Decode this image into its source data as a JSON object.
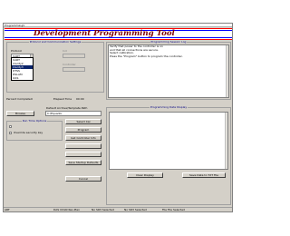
{
  "window": {
    "title": "ProgrammingV"
  },
  "banner": {
    "title": "Development Programming Tool",
    "stripe_colors": [
      "#ff0000",
      "#0000ff"
    ]
  },
  "protocol": {
    "group_title": "Protocol and Communication Settings",
    "protocol_label": "Protocol",
    "selected": "UART",
    "options": [
      "UART",
      "Clarity2",
      "Clarity3",
      "DTSS",
      "DSLAM",
      "ILSS"
    ],
    "highlighted_option": "Clarity3",
    "right_label": "Ind",
    "controller_label": "Controller"
  },
  "progress": {
    "percent_label": "Percent Complete",
    "percent_value": "0",
    "elapsed_label": "Elapsed Time",
    "elapsed_value": "00:00"
  },
  "archive": {
    "group_title": "Default Archive/Template Path",
    "browse_label": "Browse",
    "path_value": "C:\\Equador"
  },
  "run_options": {
    "group_title": "Run Time Options",
    "option1": "",
    "option2": "Override security key"
  },
  "actions": {
    "select_cal": "Select Cal",
    "program": "Program",
    "get_controller_info": "Get Controller Info",
    "disabled1": "",
    "disabled2": "",
    "save_startup_defaults": "Save Startup Defaults",
    "cancel": "Cancel"
  },
  "session_log": {
    "group_title": "Programming Session Log",
    "lines": [
      "Verify that power to the controller is on",
      "  and that all connections are secure.",
      "Select calibration.",
      "Press the \"Program\" button to program the controller."
    ]
  },
  "data_display": {
    "group_title": "Programming Data Display",
    "clear_display": "Clear Display",
    "save_data": "Save Data to TXT File"
  },
  "status_bar": {
    "c1": "ART",
    "c2": "DAS CDLN Rev.Plex",
    "c3": "No SR3 Selected",
    "c4": "No SR3 Selected",
    "c5": "File File Selected"
  }
}
